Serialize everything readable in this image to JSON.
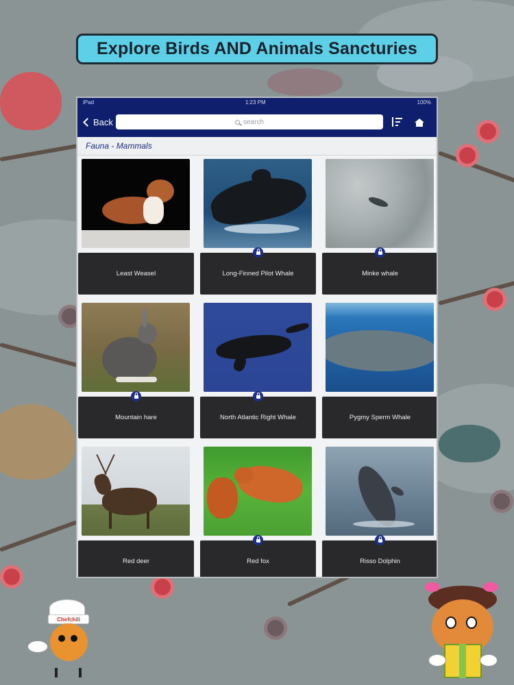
{
  "banner": {
    "title": "Explore Birds AND Animals Sancturies"
  },
  "statusbar": {
    "left": "iPad",
    "center": "1:23 PM",
    "right": "100%"
  },
  "navbar": {
    "back_label": "Back",
    "search_placeholder": "search",
    "sort_icon": "sort-icon",
    "home_icon": "home-icon"
  },
  "section": {
    "title": "Fauna - Mammals"
  },
  "animals": [
    {
      "name": "Least Weasel",
      "locked": false,
      "photo": "weasel"
    },
    {
      "name": "Long-Finned Pilot Whale",
      "locked": true,
      "photo": "pilot-whale"
    },
    {
      "name": "Minke whale",
      "locked": true,
      "photo": "minke-whale"
    },
    {
      "name": "Mountain hare",
      "locked": true,
      "photo": "hare"
    },
    {
      "name": "North Atlantic Right Whale",
      "locked": true,
      "photo": "right-whale"
    },
    {
      "name": "Pygmy Sperm Whale",
      "locked": false,
      "photo": "sperm-whale"
    },
    {
      "name": "Red deer",
      "locked": false,
      "photo": "deer"
    },
    {
      "name": "Red fox",
      "locked": true,
      "photo": "fox"
    },
    {
      "name": "Risso Dolphin",
      "locked": true,
      "photo": "dolphin"
    }
  ],
  "mascots": {
    "left_badge": "Chefchili"
  },
  "colors": {
    "nav": "#0f1f6e",
    "accent": "#1c2f8a",
    "banner": "#5dd0e8",
    "label_bg": "#29292b"
  }
}
